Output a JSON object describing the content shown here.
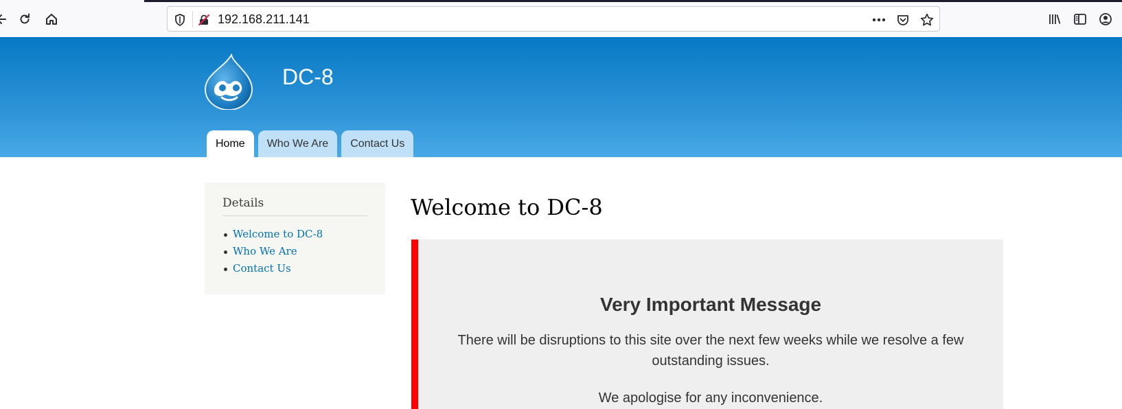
{
  "browser": {
    "url": "192.168.211.141",
    "icons": {
      "back": "back-arrow-icon",
      "reload": "reload-icon",
      "home": "home-icon",
      "tracking": "shield-icon",
      "insecure": "insecure-lock-icon",
      "more": "more-icon",
      "pocket": "pocket-icon",
      "bookmark": "star-icon",
      "library": "library-icon",
      "sidebar": "sidebar-icon",
      "account": "account-icon"
    }
  },
  "site": {
    "name": "DC-8",
    "logo": "drupal-drop-logo",
    "tabs": [
      {
        "label": "Home",
        "active": true
      },
      {
        "label": "Who We Are",
        "active": false
      },
      {
        "label": "Contact Us",
        "active": false
      }
    ]
  },
  "sidebar": {
    "title": "Details",
    "links": [
      {
        "label": "Welcome to DC-8"
      },
      {
        "label": "Who We Are"
      },
      {
        "label": "Contact Us"
      }
    ]
  },
  "main": {
    "title": "Welcome to DC-8",
    "message": {
      "heading": "Very Important Message",
      "body": "There will be disruptions to this site over the next few weeks while we resolve a few outstanding issues.",
      "apology": "We apologise for any inconvenience."
    }
  },
  "colors": {
    "header_top": "#0779c5",
    "header_bottom": "#48a9e6",
    "link": "#0071b3",
    "alert_border": "#ff0000",
    "message_bg": "#efefef",
    "sidebar_bg": "#f6f6f2"
  }
}
